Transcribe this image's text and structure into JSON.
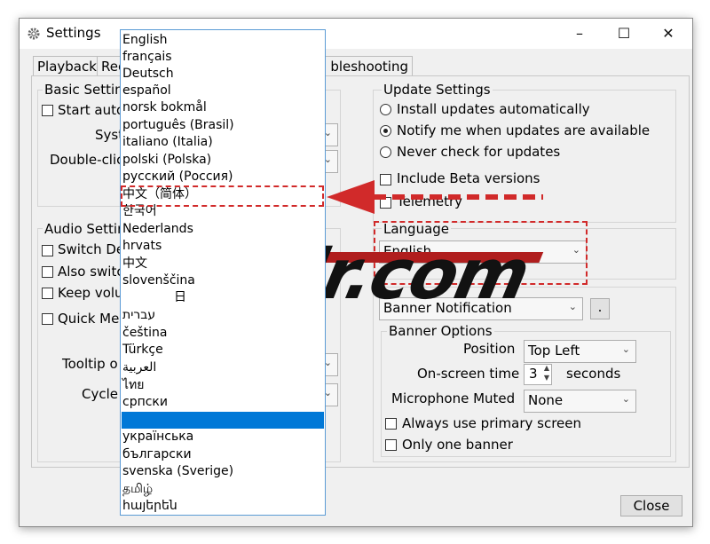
{
  "window": {
    "title": "Settings",
    "minimize": "–",
    "maximize": "☐",
    "close": "✕"
  },
  "tabs": [
    "Playback",
    "Rec",
    "bleshooting"
  ],
  "basic_settings": {
    "title": "Basic Setting",
    "start_auto": "Start auto",
    "sys": "Syst",
    "double_click": "Double-clic"
  },
  "audio_settings": {
    "title": "Audio Settin",
    "switch_de": "Switch De",
    "also_switch": "Also switc",
    "keep_volume": "Keep volu",
    "quick_me": "Quick Me",
    "tooltip": "Tooltip o",
    "cycle": "Cycle"
  },
  "update_settings": {
    "title": "Update Settings",
    "opt_auto": "Install updates automatically",
    "opt_notify": "Notify me when updates are available",
    "opt_never": "Never check for updates",
    "selected": "notify",
    "beta": "Include Beta versions",
    "telemetry": "Telemetry"
  },
  "language": {
    "title": "Language",
    "value": "English"
  },
  "notifications": {
    "value": "Banner Notification",
    "more_button": "."
  },
  "banner_options": {
    "title": "Banner Options",
    "position_label": "Position",
    "position_value": "Top Left",
    "ontime_label": "On-screen time",
    "ontime_value": "3",
    "ontime_unit": "seconds",
    "mic_label": "Microphone Muted",
    "mic_value": "None",
    "always_primary": "Always use primary screen",
    "only_one": "Only one banner"
  },
  "close_button": "Close",
  "language_list": [
    "English",
    "français",
    "Deutsch",
    "español",
    "norsk bokmål",
    "português (Brasil)",
    "italiano (Italia)",
    "polski (Polska)",
    "русский (Россия)",
    "中文（简体）",
    "한국어",
    "Nederlands",
    "hrvats",
    "中文",
    "slovenščina",
    "日",
    "עברית",
    "čeština",
    "Türkçe",
    "العربية",
    "ไทย",
    "српски",
    "",
    "українська",
    "български",
    "svenska (Sverige)",
    "தமிழ்",
    "հայերեն"
  ],
  "watermark": "Silr.com",
  "colors": {
    "accent": "#0078d7",
    "highlight_red": "#d12a2a"
  }
}
